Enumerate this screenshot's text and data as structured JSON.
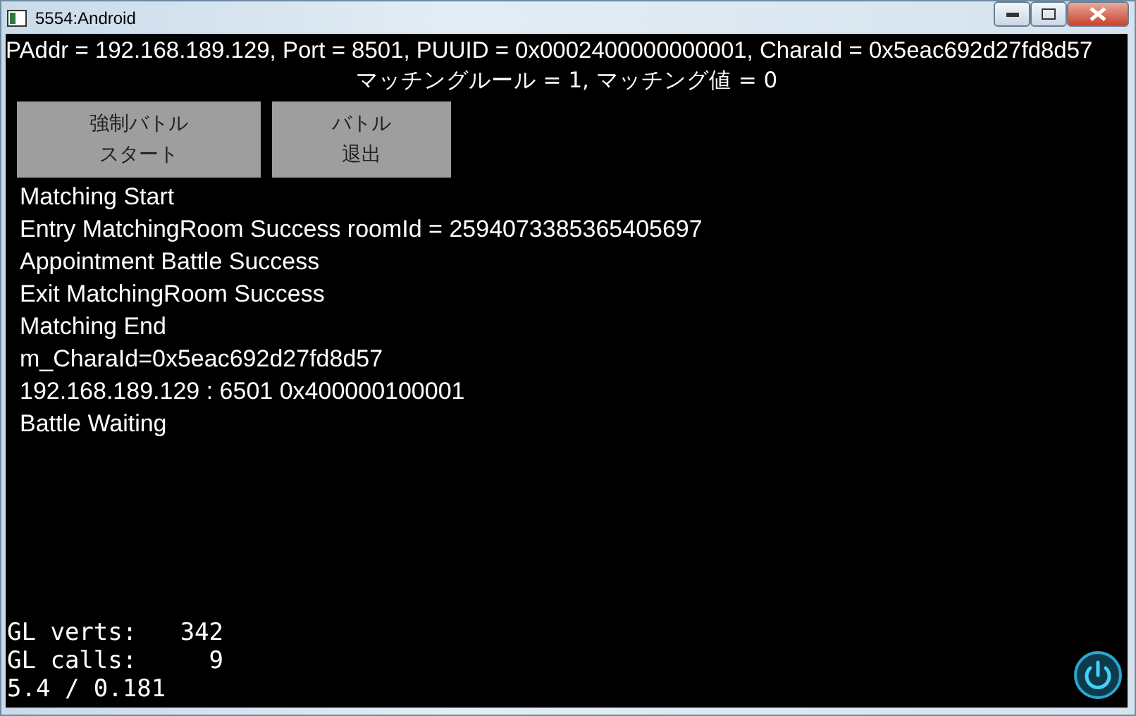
{
  "window": {
    "title": "5554:Android"
  },
  "header": {
    "line": "PAddr = 192.168.189.129, Port = 8501, PUUID = 0x0002400000000001, CharaId = 0x5eac692d27fd8d57",
    "subline": "マッチングルール = 1, マッチング値 = 0"
  },
  "buttons": [
    {
      "lines": [
        "強制バトル",
        "スタート"
      ],
      "kind": "wide"
    },
    {
      "lines": [
        "バトル",
        "退出"
      ],
      "kind": "narrow"
    }
  ],
  "log": [
    "Matching Start",
    "Entry MatchingRoom Success roomId = 2594073385365405697",
    "Appointment Battle Success",
    "Exit MatchingRoom Success",
    "Matching End",
    "m_CharaId=0x5eac692d27fd8d57",
    "192.168.189.129 : 6501 0x400000100001",
    "Battle Waiting"
  ],
  "stats": [
    "GL verts:   342",
    "GL calls:     9",
    "5.4 / 0.181"
  ]
}
